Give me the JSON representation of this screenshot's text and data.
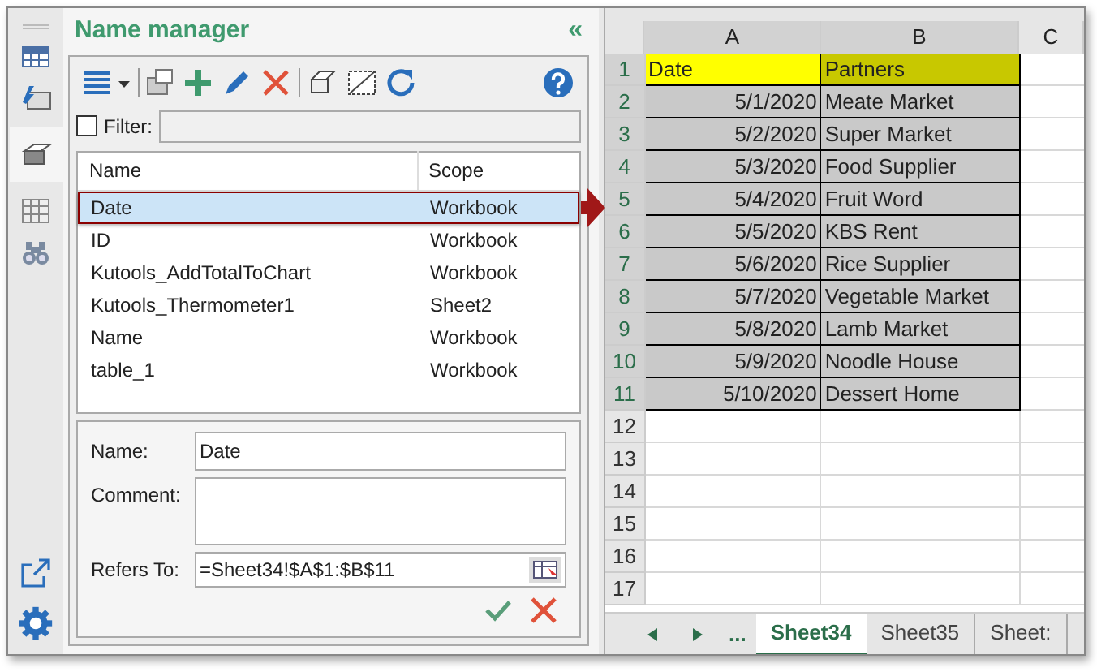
{
  "panel": {
    "title": "Name manager",
    "collapse": "«"
  },
  "filter": {
    "label": "Filter:",
    "checked": false
  },
  "names": {
    "columns": [
      "Name",
      "Scope"
    ],
    "rows": [
      {
        "name": "Date",
        "scope": "Workbook",
        "selected": true
      },
      {
        "name": "ID",
        "scope": "Workbook",
        "selected": false
      },
      {
        "name": "Kutools_AddTotalToChart",
        "scope": "Workbook",
        "selected": false
      },
      {
        "name": "Kutools_Thermometer1",
        "scope": "Sheet2",
        "selected": false
      },
      {
        "name": "Name",
        "scope": "Workbook",
        "selected": false
      },
      {
        "name": "table_1",
        "scope": "Workbook",
        "selected": false
      }
    ]
  },
  "form": {
    "name_label": "Name:",
    "name_value": "Date",
    "comment_label": "Comment:",
    "refers_label": "Refers To:",
    "refers_value": "=Sheet34!$A$1:$B$11"
  },
  "sheet": {
    "columns": [
      "A",
      "B",
      "C"
    ],
    "rows": [
      {
        "number": "1",
        "cells": [
          "Date",
          "Partners"
        ],
        "kind": "header"
      },
      {
        "number": "2",
        "cells": [
          "5/1/2020",
          "Meate Market"
        ],
        "kind": "data"
      },
      {
        "number": "3",
        "cells": [
          "5/2/2020",
          "Super Market"
        ],
        "kind": "data"
      },
      {
        "number": "4",
        "cells": [
          "5/3/2020",
          "Food Supplier"
        ],
        "kind": "data"
      },
      {
        "number": "5",
        "cells": [
          "5/4/2020",
          "Fruit Word"
        ],
        "kind": "data"
      },
      {
        "number": "6",
        "cells": [
          "5/5/2020",
          "KBS Rent"
        ],
        "kind": "data"
      },
      {
        "number": "7",
        "cells": [
          "5/6/2020",
          "Rice Supplier"
        ],
        "kind": "data"
      },
      {
        "number": "8",
        "cells": [
          "5/7/2020",
          "Vegetable Market"
        ],
        "kind": "data"
      },
      {
        "number": "9",
        "cells": [
          "5/8/2020",
          "Lamb Market"
        ],
        "kind": "data"
      },
      {
        "number": "10",
        "cells": [
          "5/9/2020",
          "Noodle House"
        ],
        "kind": "data"
      },
      {
        "number": "11",
        "cells": [
          "5/10/2020",
          "Dessert Home"
        ],
        "kind": "data"
      },
      {
        "number": "12",
        "cells": [],
        "kind": "empty"
      },
      {
        "number": "13",
        "cells": [],
        "kind": "empty"
      },
      {
        "number": "14",
        "cells": [],
        "kind": "empty"
      },
      {
        "number": "15",
        "cells": [],
        "kind": "empty"
      },
      {
        "number": "16",
        "cells": [],
        "kind": "empty"
      },
      {
        "number": "17",
        "cells": [],
        "kind": "empty"
      }
    ],
    "more_tabs": "...",
    "tabs": [
      {
        "label": "Sheet34",
        "selected": true
      },
      {
        "label": "Sheet35",
        "selected": false
      },
      {
        "label": "Sheet:",
        "selected": false
      }
    ]
  }
}
